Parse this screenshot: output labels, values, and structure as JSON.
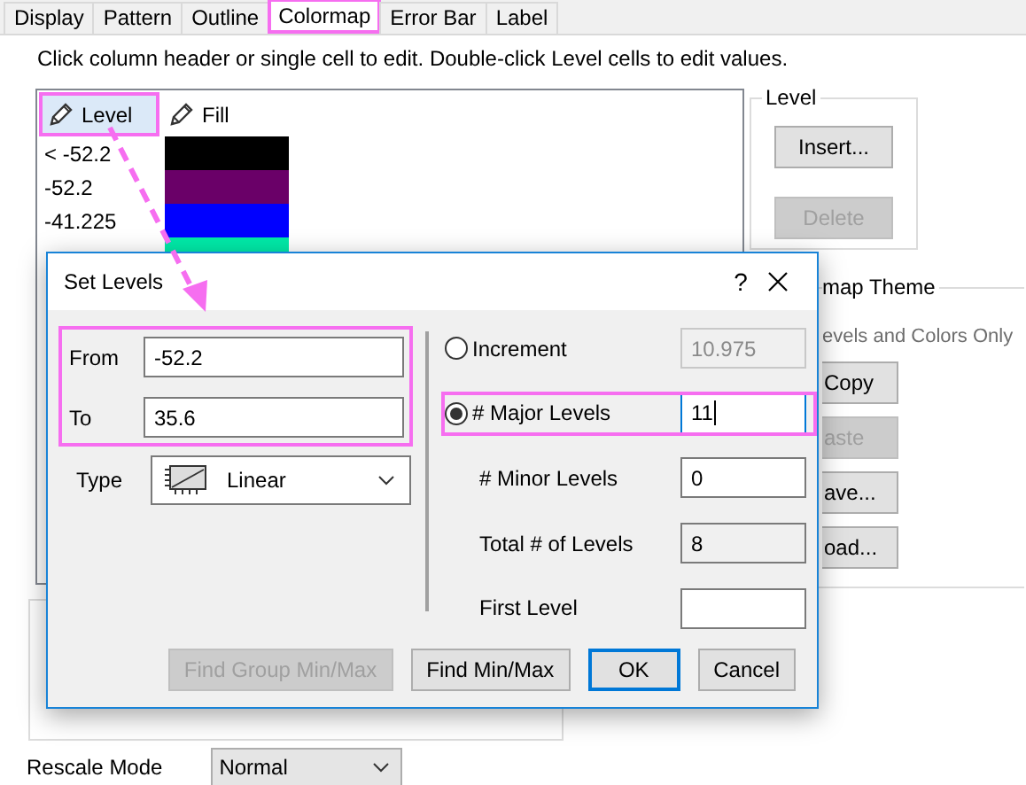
{
  "tabs": [
    {
      "label": "Display",
      "selected": false,
      "highlighted": false
    },
    {
      "label": "Pattern",
      "selected": false,
      "highlighted": false
    },
    {
      "label": "Outline",
      "selected": false,
      "highlighted": false
    },
    {
      "label": "Colormap",
      "selected": true,
      "highlighted": true
    },
    {
      "label": "Error Bar",
      "selected": false,
      "highlighted": false
    },
    {
      "label": "Label",
      "selected": false,
      "highlighted": false
    }
  ],
  "instruction": "Click column header or single cell to edit. Double-click Level cells to edit values.",
  "level_table": {
    "columns": [
      {
        "label": "Level",
        "highlighted": true
      },
      {
        "label": "Fill",
        "highlighted": false
      }
    ],
    "rows": [
      {
        "level": "< -52.2",
        "color": "#000000"
      },
      {
        "level": "-52.2",
        "color": "#6a0068"
      },
      {
        "level": "-41.225",
        "color": "#0000ff"
      },
      {
        "color": "#00eaa8"
      }
    ]
  },
  "level_group": {
    "title": "Level",
    "buttons": [
      {
        "label": "Insert...",
        "disabled": false
      },
      {
        "label": "Delete",
        "disabled": true
      }
    ]
  },
  "theme_group": {
    "title": "map Theme",
    "option": "evels and Colors Only",
    "buttons": [
      {
        "label": "Copy",
        "disabled": false
      },
      {
        "label": "aste",
        "disabled": true
      },
      {
        "label": "ave...",
        "disabled": false
      },
      {
        "label": "oad...",
        "disabled": false
      }
    ]
  },
  "rescale_mode": {
    "label": "Rescale Mode",
    "value": "Normal"
  },
  "dialog": {
    "title": "Set Levels",
    "help": "?",
    "range": {
      "highlighted": true,
      "from": {
        "label": "From",
        "value": "-52.2"
      },
      "to": {
        "label": "To",
        "value": "35.6"
      }
    },
    "type": {
      "label": "Type",
      "value": "Linear"
    },
    "options": [
      {
        "kind": "radio",
        "label": "Increment",
        "selected": false,
        "value": "10.975",
        "disabled": true,
        "focused": false,
        "highlighted": false
      },
      {
        "kind": "radio",
        "label": "# Major Levels",
        "selected": true,
        "value": "11",
        "disabled": false,
        "focused": true,
        "highlighted": true
      },
      {
        "kind": "field",
        "label": "# Minor Levels",
        "value": "0",
        "disabled": false,
        "focused": false,
        "highlighted": false
      },
      {
        "kind": "readout",
        "label": "Total # of Levels",
        "value": "8",
        "disabled": false,
        "focused": false,
        "highlighted": false
      },
      {
        "kind": "field",
        "label": "First Level",
        "disabled": false,
        "focused": false,
        "highlighted": false
      }
    ],
    "buttons": [
      {
        "label": "Find Group Min/Max",
        "disabled": true,
        "default": false
      },
      {
        "label": "Find Min/Max",
        "disabled": false,
        "default": false
      },
      {
        "label": "OK",
        "disabled": false,
        "default": true
      },
      {
        "label": "Cancel",
        "disabled": false,
        "default": false
      }
    ]
  }
}
